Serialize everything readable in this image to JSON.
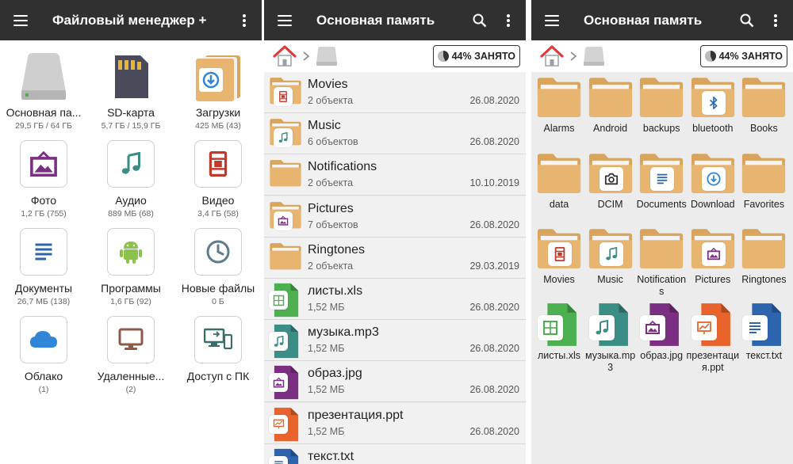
{
  "colors": {
    "appbar": "#303030",
    "folder": "#E7B56F",
    "folder_dark": "#D9A45C",
    "accent_blue": "#2F86D8",
    "green": "#4CAF50",
    "purple": "#7B2F82",
    "red": "#C0392B",
    "teal": "#3A8E86",
    "orange": "#E8642C",
    "doc_blue": "#2C64AE"
  },
  "screen1": {
    "title": "Файловый менеджер +",
    "tiles": [
      {
        "name": "Основная па...",
        "sub": "29,5 ГБ / 64 ГБ",
        "icon": "internal-drive-icon"
      },
      {
        "name": "SD-карта",
        "sub": "5,7 ГБ / 15,9 ГБ",
        "icon": "sd-card-icon"
      },
      {
        "name": "Загрузки",
        "sub": "425 МБ (43)",
        "icon": "downloads-icon"
      },
      {
        "name": "Фото",
        "sub": "1,2 ГБ (755)",
        "icon": "photo-icon"
      },
      {
        "name": "Аудио",
        "sub": "889 МБ (68)",
        "icon": "music-note-icon"
      },
      {
        "name": "Видео",
        "sub": "3,4 ГБ (58)",
        "icon": "film-icon"
      },
      {
        "name": "Документы",
        "sub": "26,7 МБ (138)",
        "icon": "document-icon"
      },
      {
        "name": "Программы",
        "sub": "1,6 ГБ (92)",
        "icon": "android-icon"
      },
      {
        "name": "Новые файлы",
        "sub": "0 Б",
        "icon": "clock-icon"
      },
      {
        "name": "Облако",
        "sub": "(1)",
        "icon": "cloud-icon"
      },
      {
        "name": "Удаленные...",
        "sub": "(2)",
        "icon": "monitor-icon"
      },
      {
        "name": "Доступ с ПК",
        "sub": "",
        "icon": "pc-access-icon"
      }
    ]
  },
  "screen2": {
    "title": "Основная память",
    "usage": "44% ЗАНЯТО",
    "rows": [
      {
        "name": "Movies",
        "sub": "2 объекта",
        "date": "26.08.2020",
        "type": "folder",
        "badge": "film"
      },
      {
        "name": "Music",
        "sub": "6 объектов",
        "date": "26.08.2020",
        "type": "folder",
        "badge": "music"
      },
      {
        "name": "Notifications",
        "sub": "2 объекта",
        "date": "10.10.2019",
        "type": "folder",
        "badge": ""
      },
      {
        "name": "Pictures",
        "sub": "7 объектов",
        "date": "26.08.2020",
        "type": "folder",
        "badge": "picture"
      },
      {
        "name": "Ringtones",
        "sub": "2 объекта",
        "date": "29.03.2019",
        "type": "folder",
        "badge": ""
      },
      {
        "name": "листы.xls",
        "sub": "1,52 МБ",
        "date": "26.08.2020",
        "type": "xls",
        "badge": ""
      },
      {
        "name": "музыка.mp3",
        "sub": "1,52 МБ",
        "date": "26.08.2020",
        "type": "mp3",
        "badge": ""
      },
      {
        "name": "образ.jpg",
        "sub": "1,52 МБ",
        "date": "26.08.2020",
        "type": "jpg",
        "badge": ""
      },
      {
        "name": "презентация.ppt",
        "sub": "1,52 МБ",
        "date": "26.08.2020",
        "type": "ppt",
        "badge": ""
      },
      {
        "name": "текст.txt",
        "sub": "",
        "date": "",
        "type": "txt",
        "badge": ""
      }
    ]
  },
  "screen3": {
    "title": "Основная память",
    "usage": "44% ЗАНЯТО",
    "items": [
      {
        "name": "Alarms",
        "type": "folder",
        "badge": ""
      },
      {
        "name": "Android",
        "type": "folder",
        "badge": ""
      },
      {
        "name": "backups",
        "type": "folder",
        "badge": ""
      },
      {
        "name": "bluetooth",
        "type": "folder",
        "badge": "bluetooth"
      },
      {
        "name": "Books",
        "type": "folder",
        "badge": ""
      },
      {
        "name": "data",
        "type": "folder",
        "badge": ""
      },
      {
        "name": "DCIM",
        "type": "folder",
        "badge": "camera"
      },
      {
        "name": "Documents",
        "type": "folder",
        "badge": "doc"
      },
      {
        "name": "Download",
        "type": "folder",
        "badge": "download"
      },
      {
        "name": "Favorites",
        "type": "folder",
        "badge": ""
      },
      {
        "name": "Movies",
        "type": "folder",
        "badge": "film"
      },
      {
        "name": "Music",
        "type": "folder",
        "badge": "music"
      },
      {
        "name": "Notifications",
        "type": "folder",
        "badge": ""
      },
      {
        "name": "Pictures",
        "type": "folder",
        "badge": "picture"
      },
      {
        "name": "Ringtones",
        "type": "folder",
        "badge": ""
      },
      {
        "name": "листы.xls",
        "type": "xls",
        "badge": ""
      },
      {
        "name": "музыка.mp3",
        "type": "mp3",
        "badge": ""
      },
      {
        "name": "образ.jpg",
        "type": "jpg",
        "badge": ""
      },
      {
        "name": "презентация.ppt",
        "type": "ppt",
        "badge": ""
      },
      {
        "name": "текст.txt",
        "type": "txt",
        "badge": ""
      }
    ]
  }
}
